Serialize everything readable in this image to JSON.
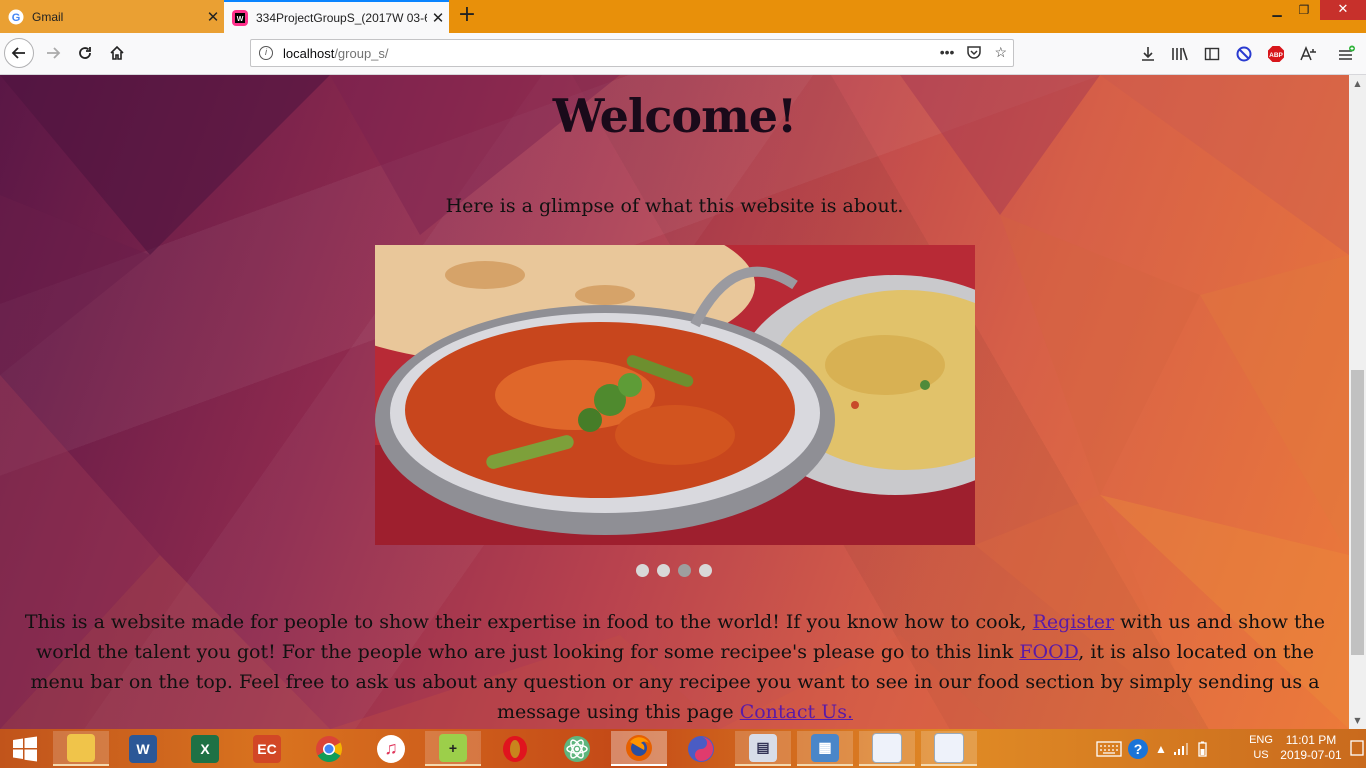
{
  "browser": {
    "tabs": [
      {
        "label": "Gmail",
        "favicon": "gmail-g-icon",
        "active": false
      },
      {
        "label": "334ProjectGroupS_(2017W 03-6",
        "favicon": "webstorm-icon",
        "active": true
      }
    ],
    "url": {
      "host": "localhost",
      "path": "/group_s/"
    }
  },
  "page": {
    "heading": "Welcome!",
    "subheading": "Here is a glimpse of what this website is about.",
    "carousel": {
      "dot_count": 4,
      "selected_index": 2,
      "image": "curry-naan-rice-photo"
    },
    "paragraph": {
      "part1": "This is a website made for people to show their expertise in food to the world! If you know how to cook, ",
      "link_register": "Register",
      "part2": " with us and show the world the talent you got! For the people who are just looking for some recipee's please go to this link ",
      "link_food": "FOOD",
      "part3": ", it is also located on the menu bar on the top. Feel free to ask us about any question or any recipee you want to see in our food section by simply sending us a message using this page ",
      "link_contact": "Contact Us."
    }
  },
  "taskbar": {
    "language": {
      "line1": "ENG",
      "line2": "US"
    },
    "time": "11:01 PM",
    "date": "2019-07-01"
  },
  "colors": {
    "accent": "#0a84ff",
    "link": "#5a1aa8",
    "titlebar": "#e8900a"
  }
}
